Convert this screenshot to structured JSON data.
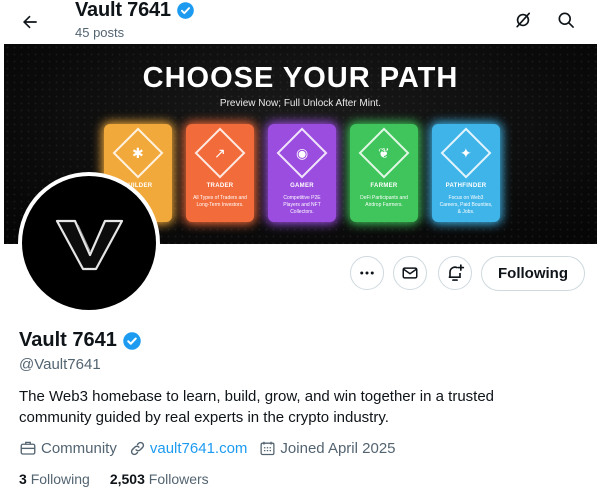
{
  "header": {
    "title": "Vault 7641",
    "posts_count": "45 posts"
  },
  "banner": {
    "headline": "CHOOSE YOUR PATH",
    "subheadline": "Preview Now; Full Unlock After Mint.",
    "cards": [
      {
        "title": "BUILDER",
        "description": "",
        "color": "#f2a93b",
        "icon": "builder-icon"
      },
      {
        "title": "TRADER",
        "description": "All Types of Traders and Long-Term Investors.",
        "color": "#f26b3a",
        "icon": "chart-icon"
      },
      {
        "title": "GAMER",
        "description": "Competitive P2E Players and NFT Collectors.",
        "color": "#9b4de0",
        "icon": "gamepad-icon"
      },
      {
        "title": "FARMER",
        "description": "DeFi Participants and Airdrop Farmers.",
        "color": "#3fc55b",
        "icon": "plant-icon"
      },
      {
        "title": "PATHFINDER",
        "description": "Focus on Web3 Careers, Paid Bounties, & Jobs.",
        "color": "#3fb4e8",
        "icon": "telescope-icon"
      }
    ]
  },
  "actions": {
    "following_label": "Following"
  },
  "profile": {
    "name": "Vault 7641",
    "handle": "@Vault7641",
    "bio": "The Web3 homebase to learn, build, grow, and win together in a trusted community guided by real experts in the crypto industry.",
    "category": "Community",
    "website": "vault7641.com",
    "joined": "Joined April 2025",
    "following_count": "3",
    "following_label": "Following",
    "followers_count": "2,503",
    "followers_label": "Followers"
  },
  "colors": {
    "accent": "#1d9bf0",
    "text": "#0f1419",
    "secondary_text": "#536471",
    "border": "#cfd9de"
  }
}
